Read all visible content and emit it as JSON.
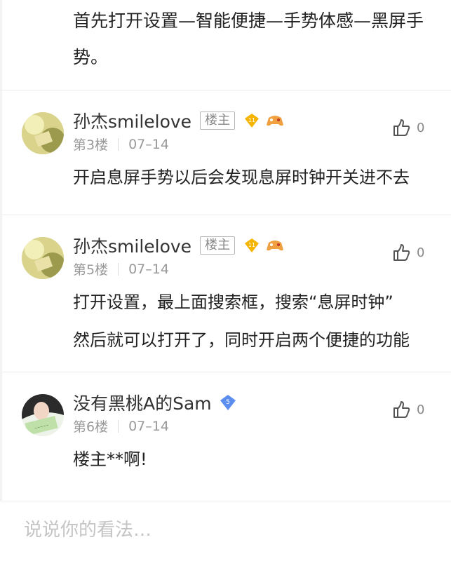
{
  "intro": {
    "lines": [
      "首先打开设置—智能便捷—手势体感—黑屏手",
      "势。"
    ]
  },
  "comments": [
    {
      "username": "孙杰smilelove",
      "op_label": "楼主",
      "level": "11",
      "floor": "第3楼",
      "date": "07–14",
      "like_count": "0",
      "lines": [
        "开启息屏手势以后会发现息屏时钟开关进不去"
      ]
    },
    {
      "username": "孙杰smilelove",
      "op_label": "楼主",
      "level": "11",
      "floor": "第5楼",
      "date": "07–14",
      "like_count": "0",
      "lines": [
        "打开设置，最上面搜索框，搜索“息屏时钟”",
        "然后就可以打开了，同时开启两个便捷的功能"
      ]
    },
    {
      "username": "没有黑桃A的Sam",
      "verify_level": "5",
      "floor": "第6楼",
      "date": "07–14",
      "like_count": "0",
      "lines": [
        "楼主**啊!"
      ]
    }
  ],
  "reply": {
    "placeholder": "说说你的看法…"
  },
  "colors": {
    "level_badge": "#f5b400",
    "verify_badge": "#5b8def",
    "game_badge": "#f0a040"
  },
  "icons": {
    "like": "thumbs-up-icon",
    "level": "level-diamond-icon",
    "game": "gamepad-icon",
    "verify": "verified-diamond-icon"
  }
}
